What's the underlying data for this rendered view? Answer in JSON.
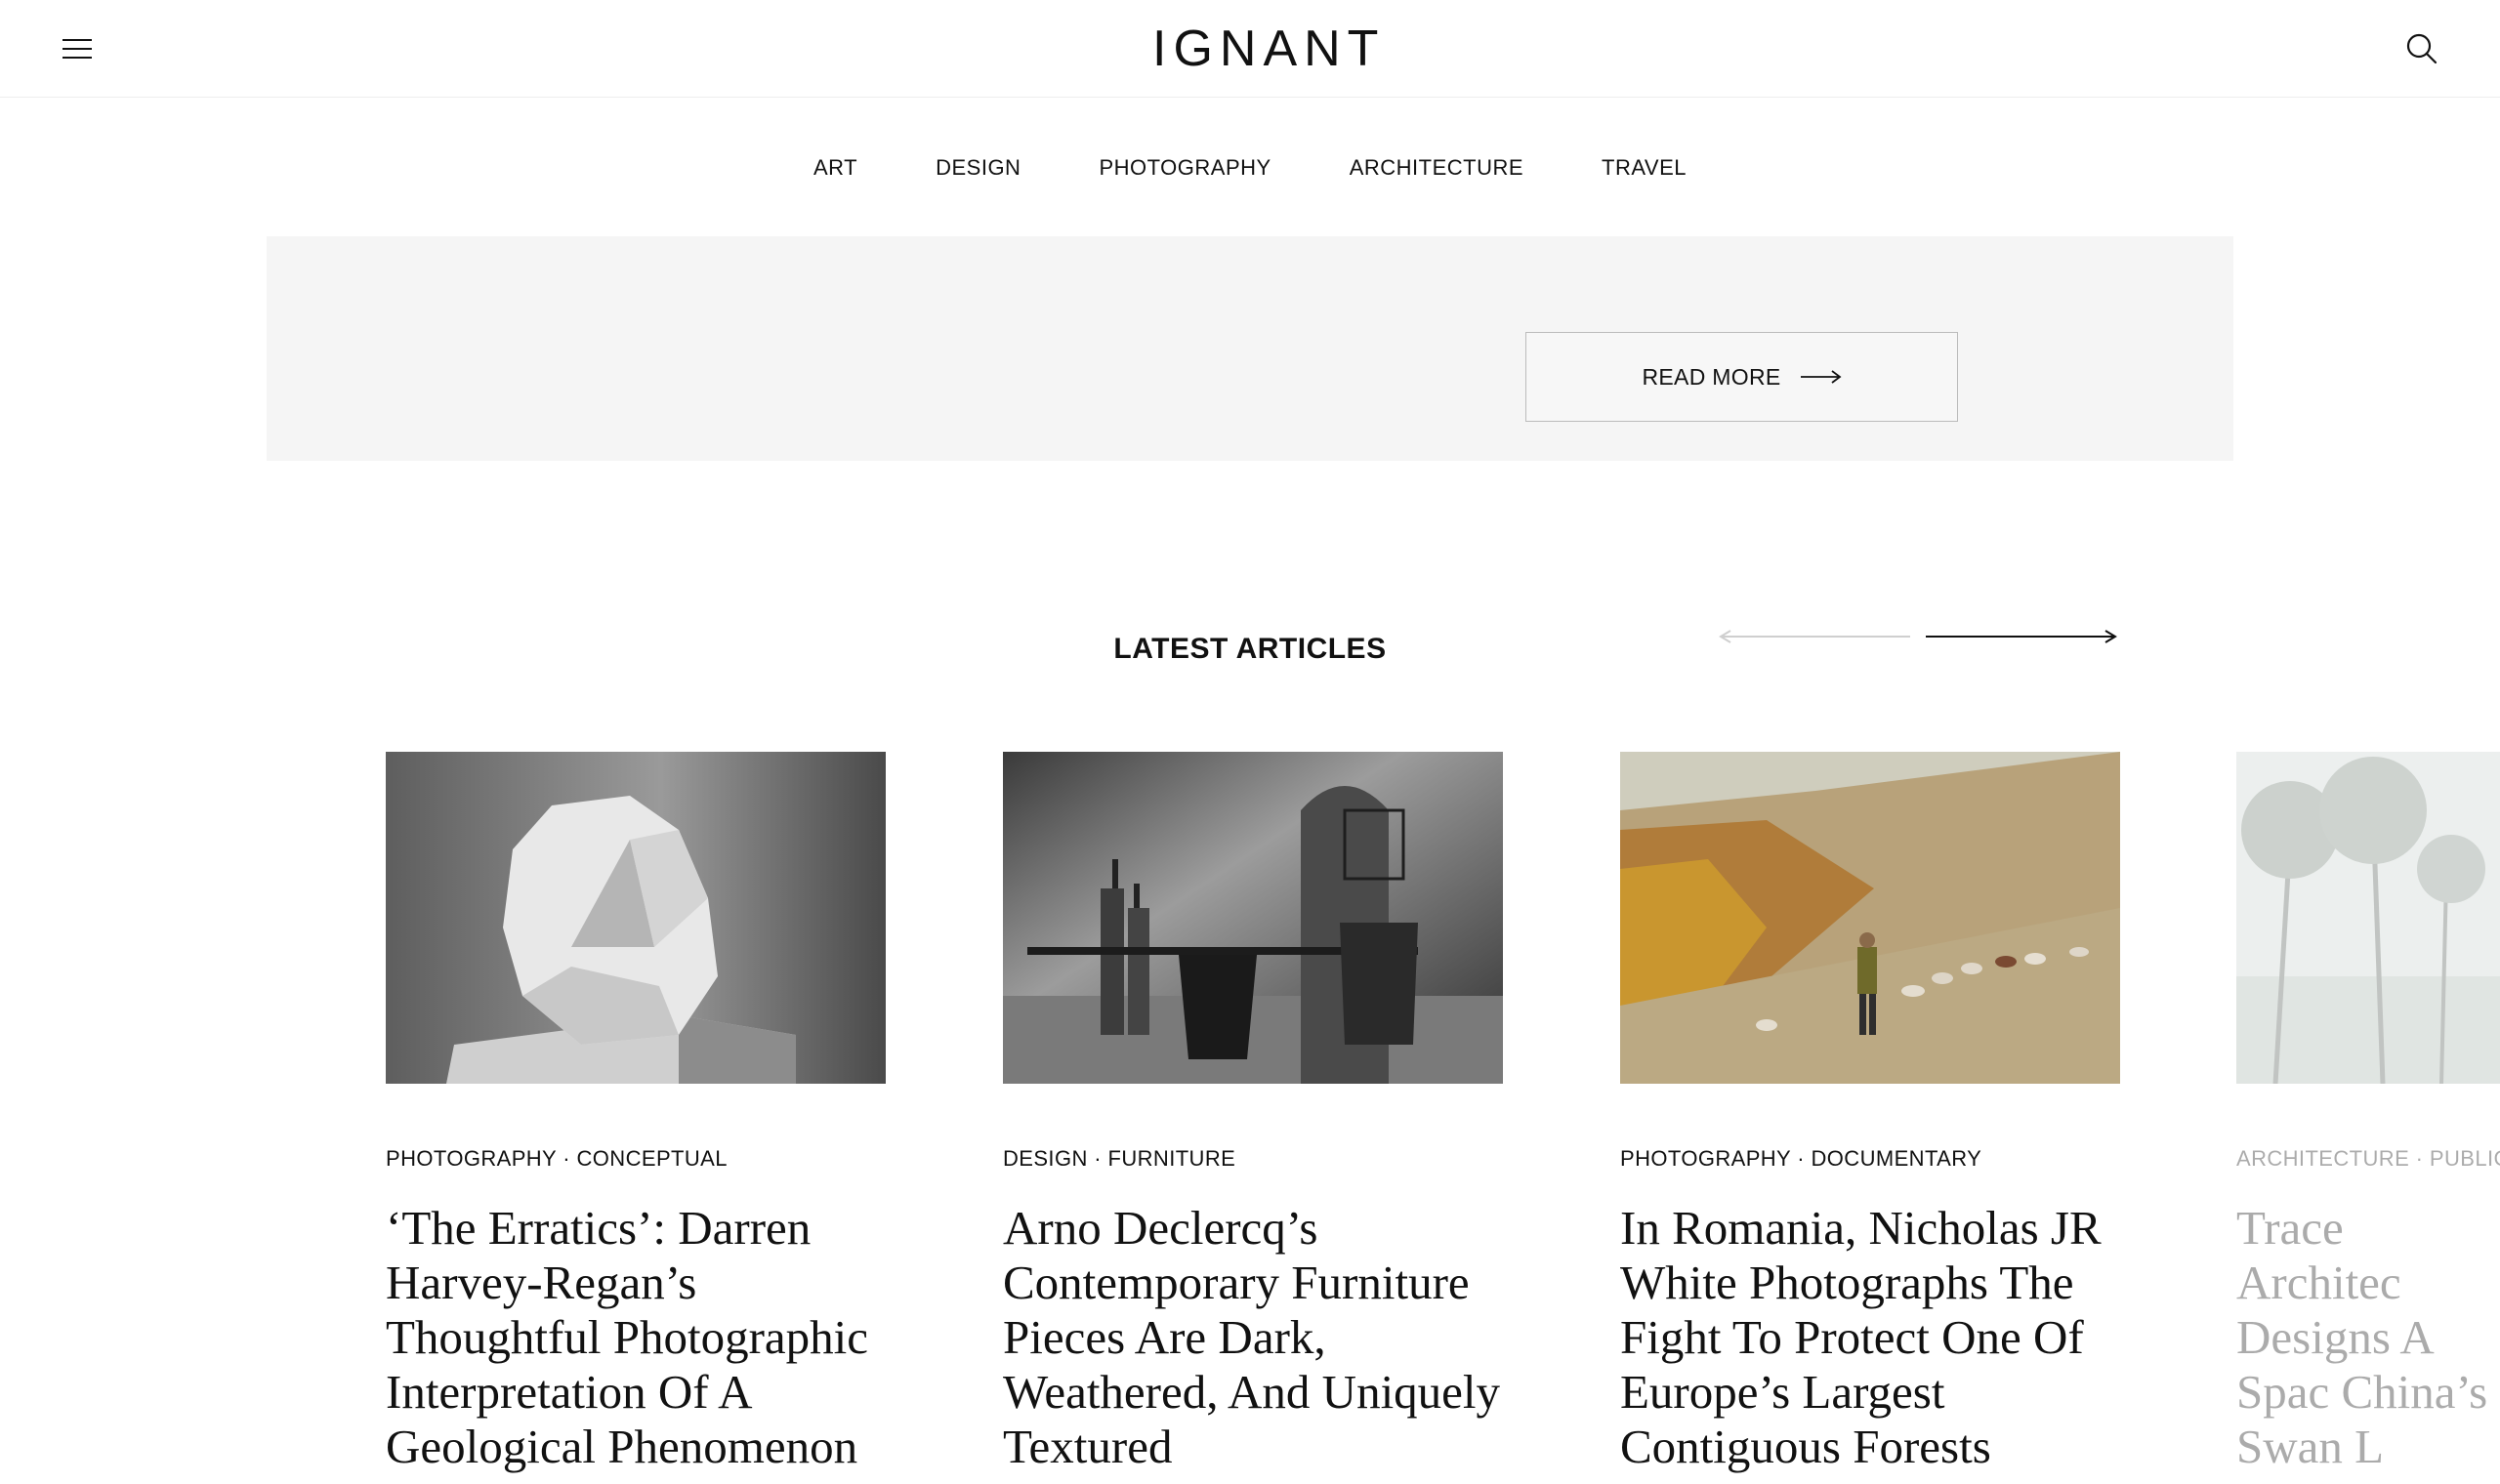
{
  "header": {
    "logo": "IGNANT",
    "menu_icon": "hamburger-menu-icon",
    "search_icon": "search-icon"
  },
  "category_nav": {
    "items": [
      "ART",
      "DESIGN",
      "PHOTOGRAPHY",
      "ARCHITECTURE",
      "TRAVEL"
    ]
  },
  "promo": {
    "read_more_label": "READ MORE",
    "read_more_icon": "arrow-right-icon"
  },
  "latest": {
    "title": "LATEST ARTICLES",
    "prev_icon": "arrow-left-icon",
    "next_icon": "arrow-right-icon",
    "articles": [
      {
        "categories": "PHOTOGRAPHY · CONCEPTUAL",
        "title": "‘The Erratics’: Darren Harvey-Regan’s Thoughtful Photographic Interpretation Of A Geological Phenomenon"
      },
      {
        "categories": "DESIGN · FURNITURE",
        "title": "Arno Declercq’s Contemporary Furniture Pieces Are Dark, Weathered, And Uniquely Textured"
      },
      {
        "categories": "PHOTOGRAPHY · DOCUMENTARY",
        "title": "In Romania, Nicholas JR White Photographs The Fight To Protect One Of Europe’s Largest Contiguous Forests"
      },
      {
        "categories": "ARCHITECTURE · PUBLIC SPA",
        "title": "Trace Architec Designs A Spac China’s Swan L"
      }
    ]
  },
  "colors": {
    "text": "#111111",
    "promo_background": "#f5f5f5",
    "divider": "#eeeeee"
  }
}
